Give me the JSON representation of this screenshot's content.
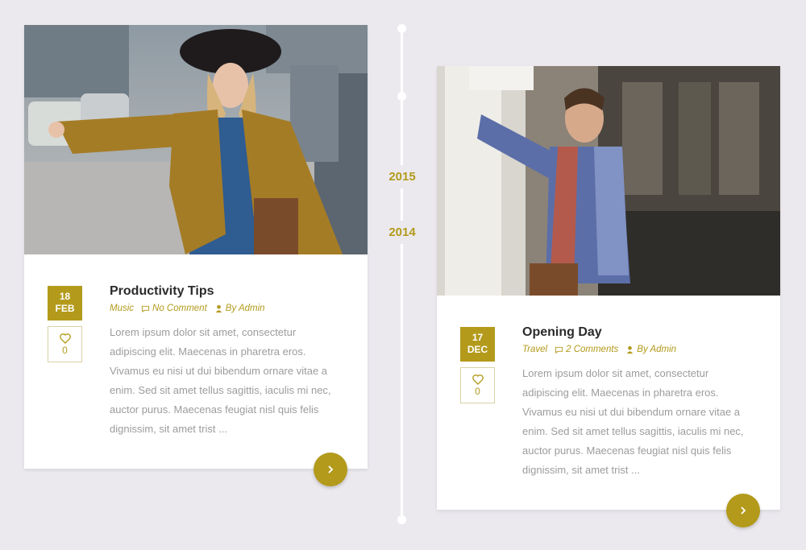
{
  "timeline": {
    "years": [
      "2015",
      "2014"
    ]
  },
  "posts": [
    {
      "day": "18",
      "month": "FEB",
      "likes": "0",
      "title": "Productivity Tips",
      "category": "Music",
      "comments": "No Comment",
      "author": "By Admin",
      "excerpt": "Lorem ipsum dolor sit amet, consectetur adipiscing elit. Maecenas in pharetra eros. Vivamus eu nisi ut dui bibendum ornare vitae a enim. Sed sit amet tellus sagittis, iaculis mi nec, auctor purus. Maecenas feugiat nisl quis felis dignissim, sit amet trist ..."
    },
    {
      "day": "17",
      "month": "DEC",
      "likes": "0",
      "title": "Opening Day",
      "category": "Travel",
      "comments": "2 Comments",
      "author": "By Admin",
      "excerpt": "Lorem ipsum dolor sit amet, consectetur adipiscing elit. Maecenas in pharetra eros. Vivamus eu nisi ut dui bibendum ornare vitae a enim. Sed sit amet tellus sagittis, iaculis mi nec, auctor purus. Maecenas feugiat nisl quis felis dignissim, sit amet trist ..."
    }
  ],
  "colors": {
    "accent": "#b39a1b",
    "background": "#ebe9ee",
    "card": "#ffffff",
    "text": "#9c9c9c"
  }
}
